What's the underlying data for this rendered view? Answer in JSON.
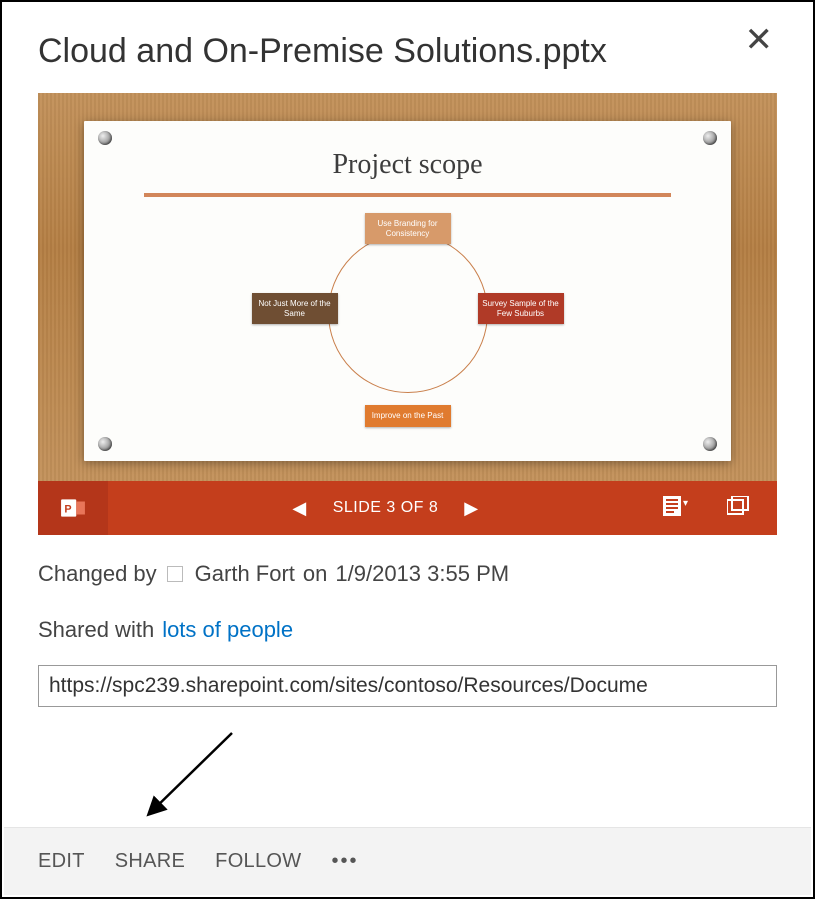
{
  "header": {
    "title": "Cloud and On-Premise Solutions.pptx"
  },
  "preview": {
    "slide_title": "Project scope",
    "nodes": {
      "top": "Use Branding for Consistency",
      "right": "Survey Sample of the Few Suburbs",
      "bottom": "Improve on the Past",
      "left": "Not Just More of the Same"
    },
    "controls": {
      "slide_label": "SLIDE 3 OF 8"
    }
  },
  "meta": {
    "changed_by_prefix": "Changed by",
    "changed_by_name": "Garth Fort",
    "changed_by_on": "on",
    "changed_date": "1/9/2013 3:55 PM",
    "shared_with_prefix": "Shared with",
    "shared_with_link": "lots of people",
    "url": "https://spc239.sharepoint.com/sites/contoso/Resources/Docume"
  },
  "footer": {
    "edit": "EDIT",
    "share": "SHARE",
    "follow": "FOLLOW",
    "more": "•••"
  },
  "colors": {
    "accent": "#c43e1c",
    "link": "#0072c6"
  }
}
